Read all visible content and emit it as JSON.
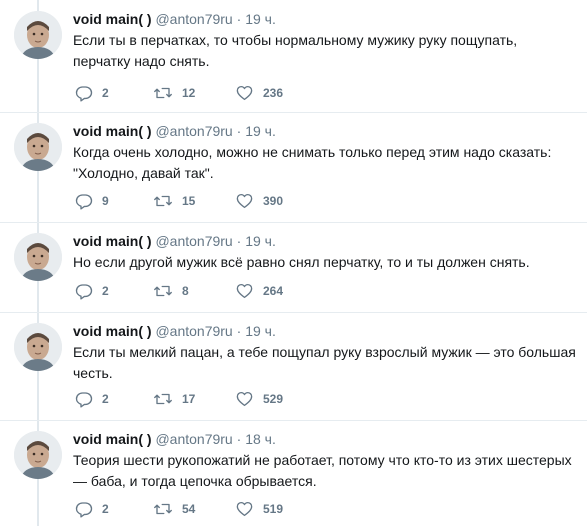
{
  "tweets": [
    {
      "name": "void main( )",
      "handle": "@anton79ru",
      "dot": "·",
      "time": "19 ч.",
      "text": "Если ты в перчатках, то чтобы нормальному мужику руку пощупать, перчатку надо снять.",
      "replies": "2",
      "retweets": "12",
      "likes": "236"
    },
    {
      "name": "void main( )",
      "handle": "@anton79ru",
      "dot": "·",
      "time": "19 ч.",
      "text": "Когда очень холодно, можно не снимать только перед этим надо сказать: \"Холодно, давай так\".",
      "replies": "9",
      "retweets": "15",
      "likes": "390"
    },
    {
      "name": "void main( )",
      "handle": "@anton79ru",
      "dot": "·",
      "time": "19 ч.",
      "text": "Но если другой мужик всё равно снял перчатку, то и ты должен снять.",
      "replies": "2",
      "retweets": "8",
      "likes": "264"
    },
    {
      "name": "void main( )",
      "handle": "@anton79ru",
      "dot": "·",
      "time": "19 ч.",
      "text": "Если ты мелкий пацан, а тебе пощупал руку взрослый мужик — это большая честь.",
      "replies": "2",
      "retweets": "17",
      "likes": "529"
    },
    {
      "name": "void main( )",
      "handle": "@anton79ru",
      "dot": "·",
      "time": "18 ч.",
      "text": "Теория шести рукопожатий не работает, потому что кто-то из этих шестерых — баба, и тогда цепочка обрывается.",
      "replies": "2",
      "retweets": "54",
      "likes": "519"
    }
  ],
  "icons": {
    "reply": "reply-icon",
    "retweet": "retweet-icon",
    "like": "heart-icon"
  },
  "colors": {
    "text": "#14171a",
    "muted": "#657786",
    "thread_line": "#e1e8ed",
    "separator": "#e6ecf0"
  }
}
